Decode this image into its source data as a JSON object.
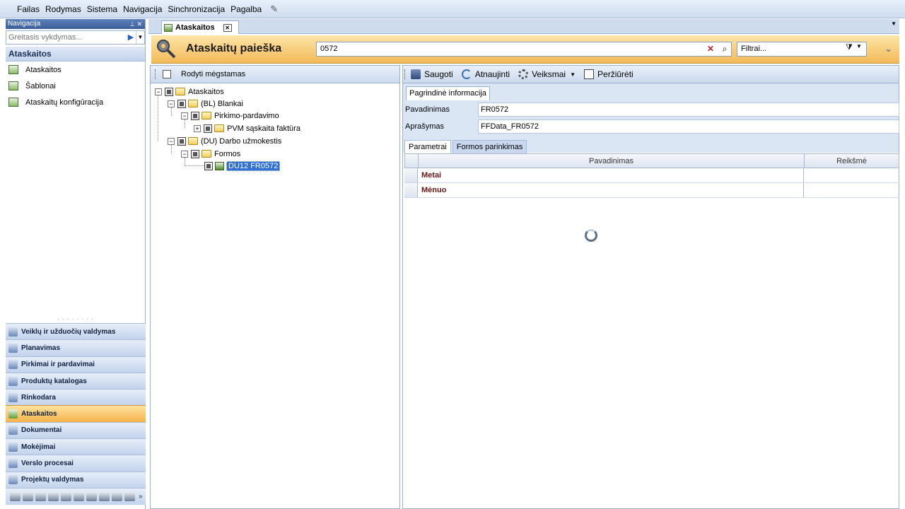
{
  "menu": [
    "Failas",
    "Rodymas",
    "Sistema",
    "Navigacija",
    "Sinchronizacija",
    "Pagalba"
  ],
  "nav": {
    "caption": "Navigacija",
    "quick_search_placeholder": "Greitasis vykdymas...",
    "section_title": "Ataskaitos",
    "links": [
      {
        "label": "Ataskaitos",
        "icon": "report-icon"
      },
      {
        "label": "Šablonai",
        "icon": "template-icon"
      },
      {
        "label": "Ataskaitų konfigūracija",
        "icon": "config-icon"
      }
    ],
    "buttons": [
      {
        "label": "Veiklų ir užduočių valdymas",
        "icon": "tasks-icon",
        "active": false
      },
      {
        "label": "Planavimas",
        "icon": "calendar-icon",
        "active": false
      },
      {
        "label": "Pirkimai ir pardavimai",
        "icon": "trade-icon",
        "active": false
      },
      {
        "label": "Produktų katalogas",
        "icon": "catalog-icon",
        "active": false
      },
      {
        "label": "Rinkodara",
        "icon": "marketing-icon",
        "active": false
      },
      {
        "label": "Ataskaitos",
        "icon": "report-icon",
        "active": true
      },
      {
        "label": "Dokumentai",
        "icon": "documents-icon",
        "active": false
      },
      {
        "label": "Mokėjimai",
        "icon": "payments-icon",
        "active": false
      },
      {
        "label": "Verslo procesai",
        "icon": "process-icon",
        "active": false
      },
      {
        "label": "Projektų valdymas",
        "icon": "projects-icon",
        "active": false
      }
    ]
  },
  "doc_tab": {
    "label": "Ataskaitos"
  },
  "header": {
    "title": "Ataskaitų paieška",
    "search_value": "0572",
    "filter_placeholder": "Filtrai..."
  },
  "tree": {
    "toolbar_label": "Rodyti mėgstamas",
    "nodes": [
      {
        "label": "Ataskaitos",
        "selected": false
      },
      {
        "label": "(BL) Blankai",
        "selected": false
      },
      {
        "label": "Pirkimo-pardavimo",
        "selected": false
      },
      {
        "label": "PVM sąskaita faktūra",
        "selected": false
      },
      {
        "label": "(DU) Darbo užmokestis",
        "selected": false
      },
      {
        "label": "Formos",
        "selected": false
      },
      {
        "label": "DU12 FR0572",
        "selected": true
      }
    ]
  },
  "details": {
    "toolbar": {
      "save": "Saugoti",
      "refresh": "Atnaujinti",
      "actions": "Veiksmai",
      "preview": "Peržiūrėti"
    },
    "info_tab": "Pagrindinė informacija",
    "fields": [
      {
        "label": "Pavadinimas",
        "value": "FR0572"
      },
      {
        "label": "Aprašymas",
        "value": "FFData_FR0572"
      }
    ],
    "param_tabs": [
      "Parametrai",
      "Formos parinkimas"
    ],
    "grid": {
      "columns": [
        "Pavadinimas",
        "Reikšmė"
      ],
      "rows": [
        {
          "name": "Metai",
          "value": ""
        },
        {
          "name": "Mėnuo",
          "value": ""
        }
      ]
    }
  }
}
